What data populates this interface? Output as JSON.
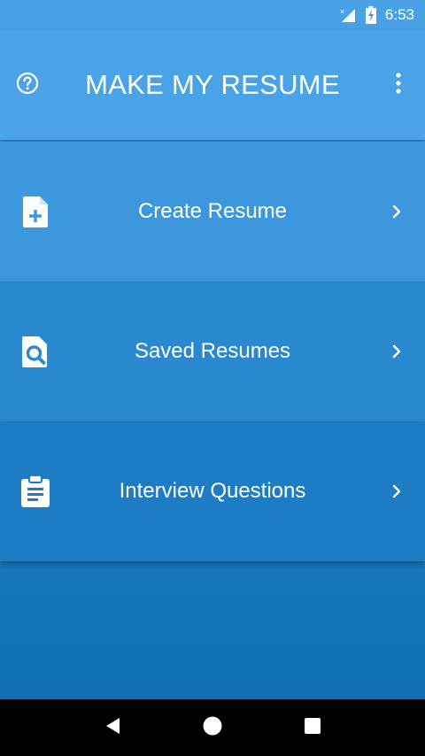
{
  "status_bar": {
    "time": "6:53",
    "icons": [
      "no-signal-icon",
      "battery-charging-icon"
    ]
  },
  "app_bar": {
    "title": "MAKE MY RESUME",
    "left_icon": "help-icon",
    "right_icon": "more-vert-icon"
  },
  "menu": {
    "items": [
      {
        "label": "Create Resume",
        "icon": "file-add-icon"
      },
      {
        "label": "Saved Resumes",
        "icon": "file-search-icon"
      },
      {
        "label": "Interview Questions",
        "icon": "clipboard-icon"
      }
    ]
  },
  "nav_bar": {
    "icons": [
      "back-icon",
      "home-icon",
      "recents-icon"
    ]
  },
  "colors": {
    "app_bar": "#4aa3e6",
    "card_1": "#3c97dc",
    "card_2": "#2a88cf",
    "card_3": "#1d7cc3",
    "nav_bar": "#000000"
  }
}
